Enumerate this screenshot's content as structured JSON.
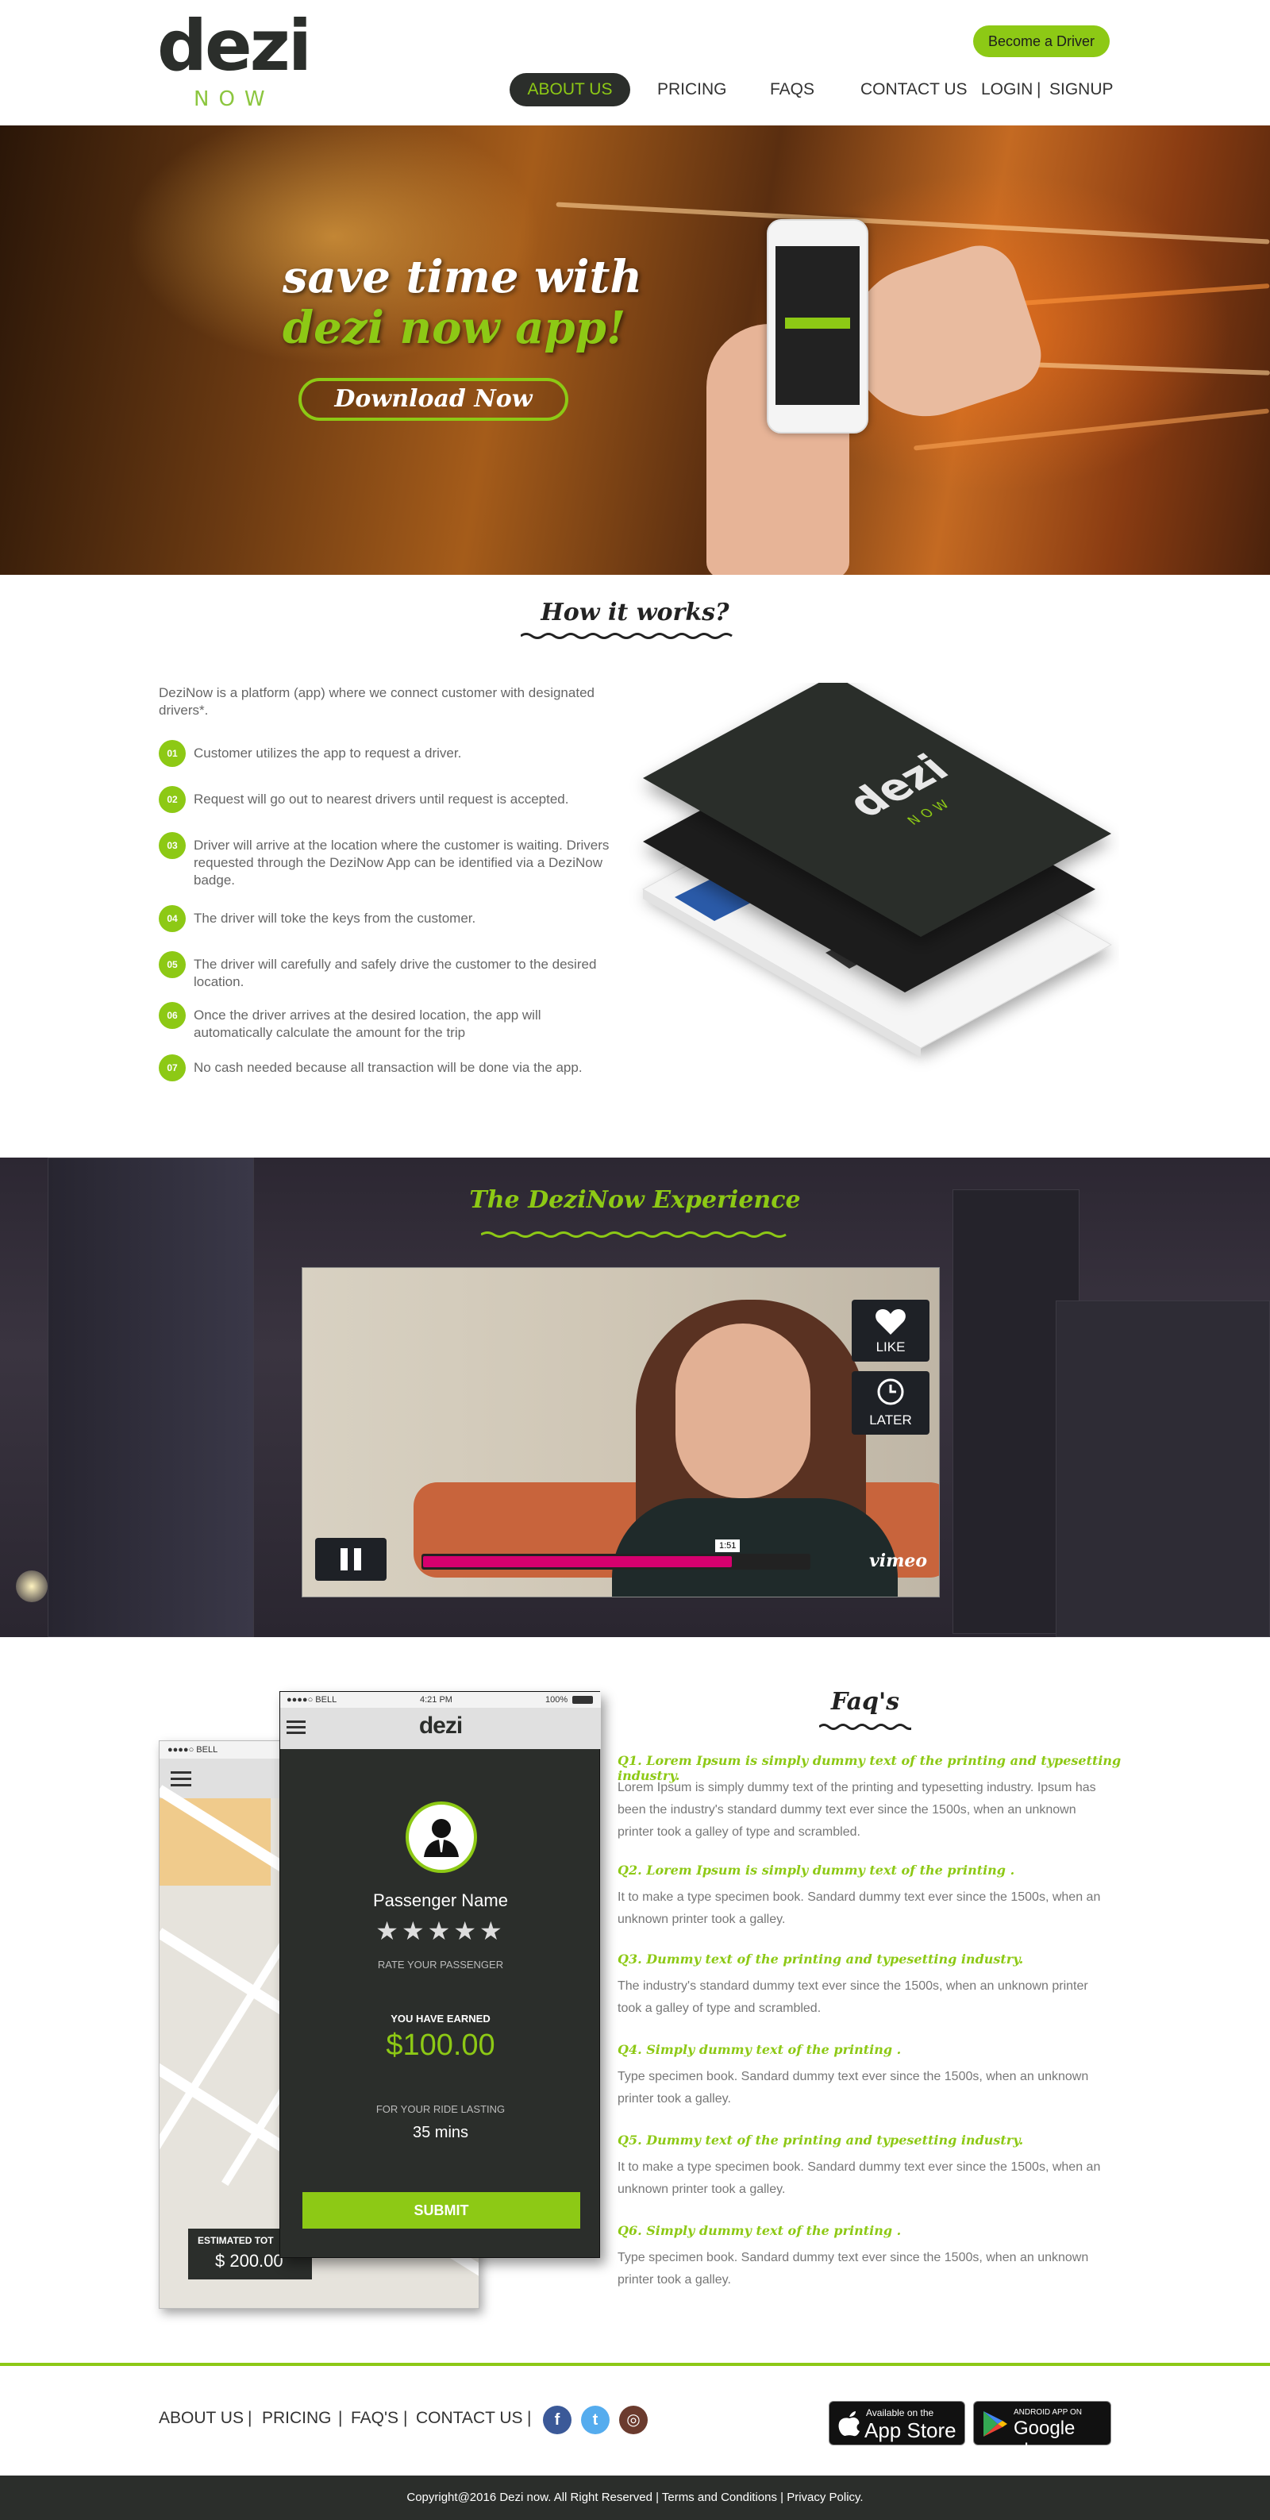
{
  "header": {
    "logo_text": "dezi",
    "logo_sub": "NOW",
    "become_driver": "Become a Driver",
    "nav": {
      "about": "ABOUT US",
      "pricing": "PRICING",
      "faqs": "FAQS",
      "contact": "CONTACT US",
      "login": "LOGIN",
      "separator": "|",
      "signup": "SIGNUP"
    }
  },
  "hero": {
    "line1": "save time with",
    "line2": "dezi now app!",
    "download_label": "Download Now"
  },
  "how": {
    "title": "How it works?",
    "intro": "DeziNow is a platform (app) where we connect customer with designated drivers*.",
    "steps": [
      {
        "num": "01",
        "text": "Customer utilizes the app to request a driver."
      },
      {
        "num": "02",
        "text": "Request will go out to nearest drivers until request is accepted."
      },
      {
        "num": "03",
        "text": "Driver will arrive at the location where the customer is waiting. Drivers requested through the DeziNow App can be identified via a DeziNow badge."
      },
      {
        "num": "04",
        "text": "The driver will toke the keys from the customer."
      },
      {
        "num": "05",
        "text": "The driver will carefully and safely drive the customer to the desired location."
      },
      {
        "num": "06",
        "text": "Once the driver arrives at the desired location, the app will automatically calculate the amount for the trip"
      },
      {
        "num": "07",
        "text": "No cash needed because all transaction will be done via the app."
      }
    ],
    "stack_logo": "dezi",
    "stack_logo_sub": "NOW"
  },
  "video": {
    "title": "The DeziNow Experience",
    "like": "LIKE",
    "later": "LATER",
    "time": "1:51",
    "progress": 0.8,
    "vimeo": "vimeo"
  },
  "app_mock": {
    "back_status": "●●●●○ BELL",
    "est_label": "ESTIMATED TOT",
    "est_value": "$ 200.00",
    "status_carrier": "●●●●○ BELL",
    "status_time": "4:21 PM",
    "status_battery": "100%",
    "logo": "dezi",
    "passenger_name": "Passenger Name",
    "stars": "★★★★★",
    "rate_label": "RATE YOUR PASSENGER",
    "earned_label": "YOU HAVE EARNED",
    "earned_value": "$100.00",
    "ride_label": "FOR YOUR RIDE LASTING",
    "ride_value": "35 mins",
    "submit": "SUBMIT"
  },
  "faq": {
    "title": "Faq's",
    "items": [
      {
        "q": "Q1. Lorem Ipsum is simply dummy text of the printing and typesetting industry.",
        "a": "Lorem Ipsum is simply dummy text of the printing and typesetting industry. Ipsum has been the industry's standard dummy text ever since the 1500s, when an unknown printer took a galley of type and scrambled."
      },
      {
        "q": "Q2. Lorem Ipsum is simply dummy text of the printing .",
        "a": "It to make a type specimen book. Sandard dummy text ever since the 1500s, when an unknown printer took a galley."
      },
      {
        "q": "Q3. Dummy text of the printing and typesetting industry.",
        "a": "The industry's standard dummy text ever since the 1500s, when an unknown printer took a galley of type and scrambled."
      },
      {
        "q": "Q4. Simply dummy text of the printing .",
        "a": "Type specimen book. Sandard dummy text ever since the 1500s, when an unknown printer took a galley."
      },
      {
        "q": "Q5. Dummy text of the printing and typesetting industry.",
        "a": "It to make a type specimen book. Sandard dummy text ever since the 1500s, when an unknown printer took a galley."
      },
      {
        "q": "Q6. Simply dummy text of the printing .",
        "a": "Type specimen book. Sandard dummy text ever since the 1500s, when an unknown printer took a galley."
      }
    ]
  },
  "footer": {
    "about": "ABOUT US",
    "pricing": "PRICING",
    "faqs": "FAQ'S",
    "contact": "CONTACT US",
    "sep": "|",
    "facebook": "f",
    "twitter": "t",
    "instagram": "◎",
    "appstore_small": "Available on the",
    "appstore_big": "App Store",
    "googleplay_small": "ANDROID APP ON",
    "googleplay_big": "Google play",
    "copyright": "Copyright@2016 Dezi now. All Right Reserved | Terms and Conditions | Privacy Policy."
  },
  "colors": {
    "accent": "#8dc915",
    "dark": "#2b2e2b",
    "progress": "#d6006e"
  }
}
